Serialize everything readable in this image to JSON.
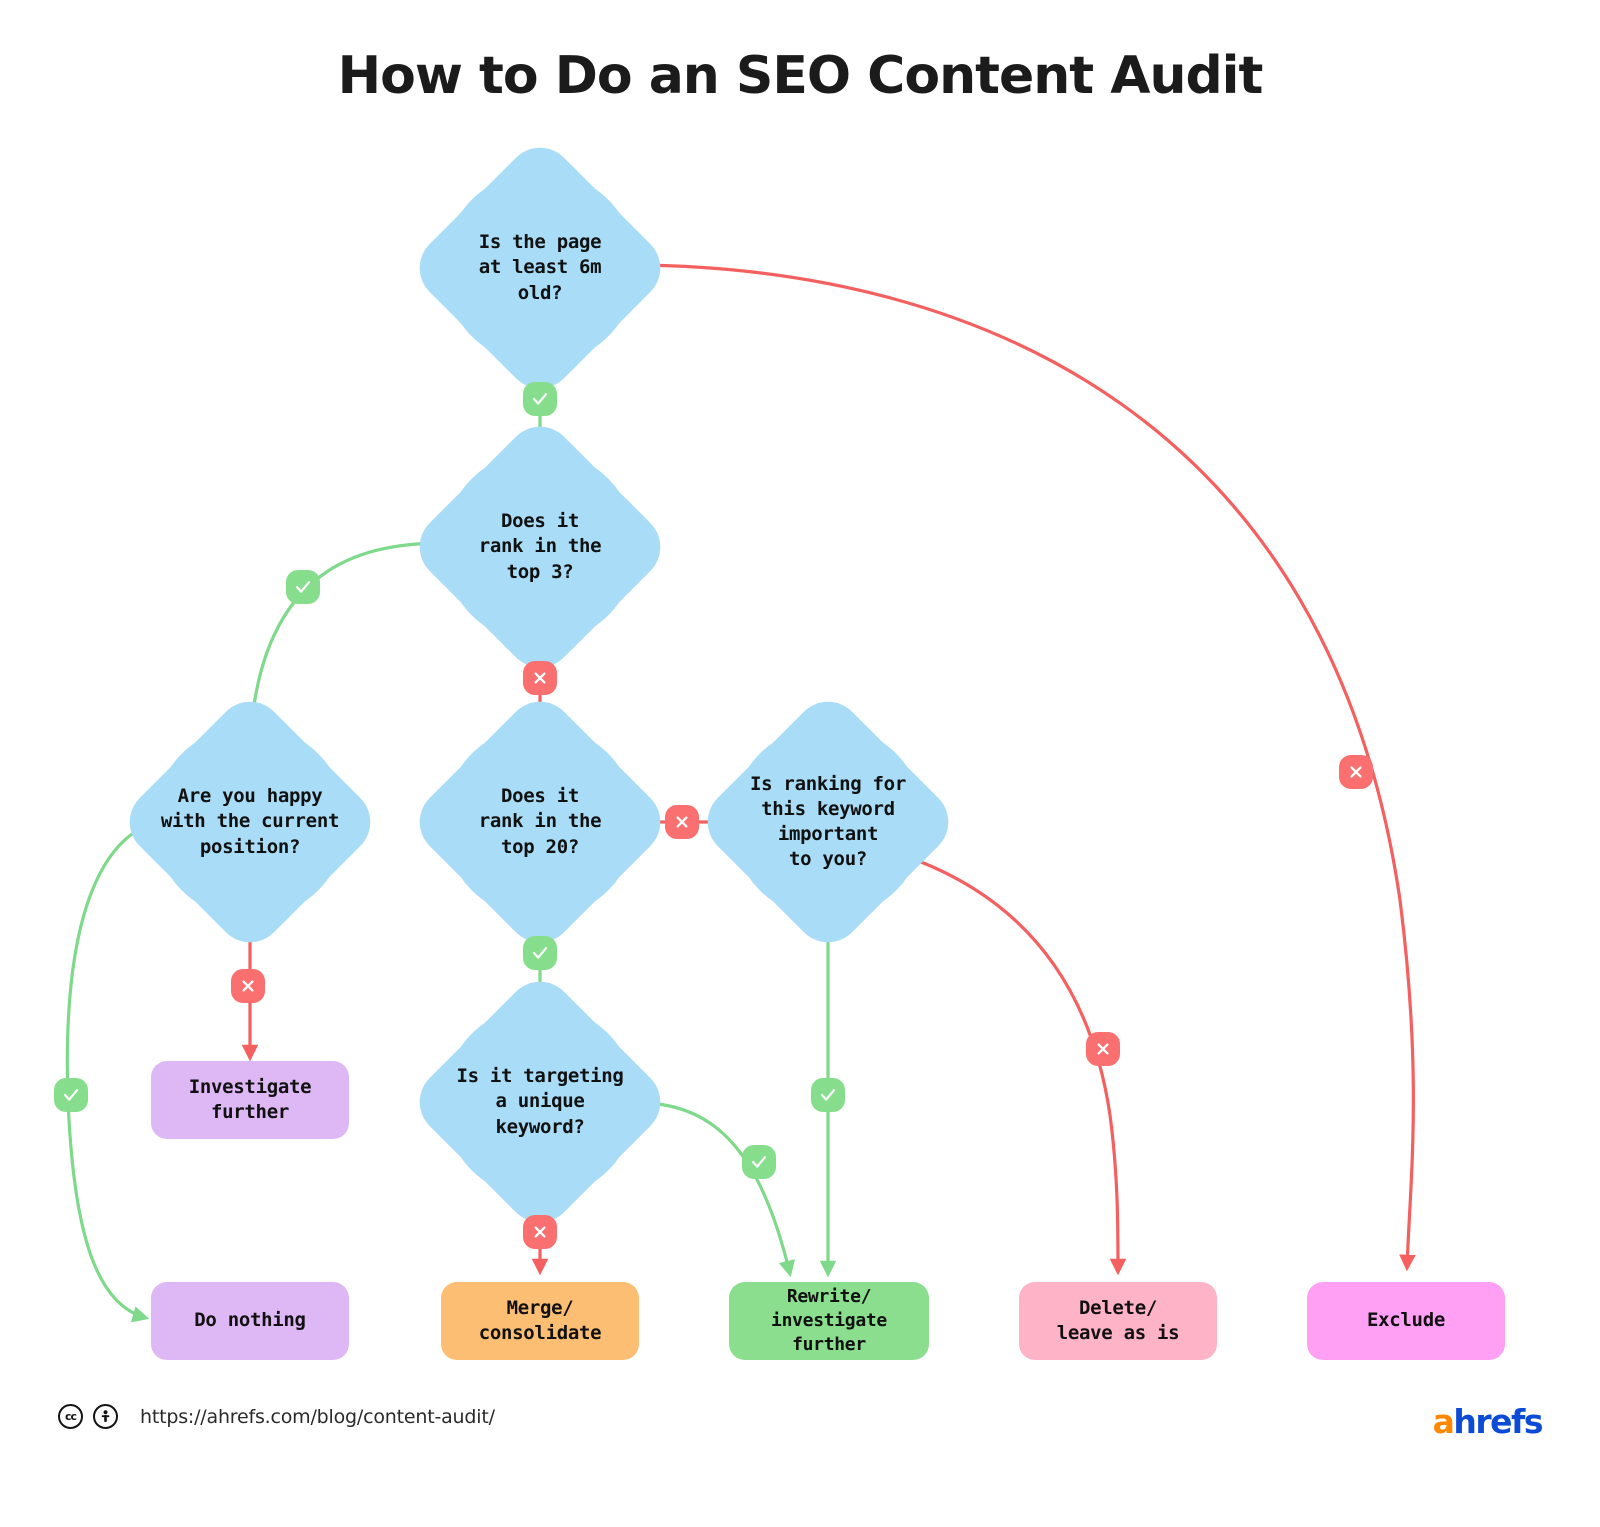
{
  "title": "How to Do an SEO Content Audit",
  "colors": {
    "decision_fill": "#a8dcf7",
    "yes_green": "#86de8d",
    "no_red": "#fa6f6f",
    "edge_green": "#7ed98a",
    "edge_red": "#f4605f",
    "purple_box": "#ddb8f5",
    "orange_box": "#fbbe72",
    "green_box": "#8ade8e",
    "pink_box": "#ffb3c7",
    "magenta_box": "#ffa0f5",
    "title_color": "#1b1b1b",
    "brand_orange": "#ff8800",
    "brand_blue": "#0b4bd6"
  },
  "nodes": {
    "q_age": "Is the page\nat least 6m\nold?",
    "q_top3": "Does it\nrank in the\ntop 3?",
    "q_happy": "Are you happy\nwith the current\nposition?",
    "q_top20": "Does it\nrank in the\ntop 20?",
    "q_important": "Is ranking for\nthis keyword\nimportant\nto you?",
    "q_unique": "Is it targeting\na unique\nkeyword?",
    "t_investigate": "Investigate\nfurther",
    "t_do_nothing": "Do nothing",
    "t_merge": "Merge/\nconsolidate",
    "t_rewrite": "Rewrite/\ninvestigate further",
    "t_delete": "Delete/\nleave as is",
    "t_exclude": "Exclude"
  },
  "edges": [
    {
      "id": "age-yes-top3",
      "from": "q_age",
      "to": "q_top3",
      "answer": "yes"
    },
    {
      "id": "age-no-exclude",
      "from": "q_age",
      "to": "t_exclude",
      "answer": "no"
    },
    {
      "id": "top3-yes-happy",
      "from": "q_top3",
      "to": "q_happy",
      "answer": "yes"
    },
    {
      "id": "top3-no-top20",
      "from": "q_top3",
      "to": "q_top20",
      "answer": "no"
    },
    {
      "id": "happy-yes-donothing",
      "from": "q_happy",
      "to": "t_do_nothing",
      "answer": "yes"
    },
    {
      "id": "happy-no-investigate",
      "from": "q_happy",
      "to": "t_investigate",
      "answer": "no"
    },
    {
      "id": "top20-yes-unique",
      "from": "q_top20",
      "to": "q_unique",
      "answer": "yes"
    },
    {
      "id": "top20-no-important",
      "from": "q_top20",
      "to": "q_important",
      "answer": "no"
    },
    {
      "id": "unique-no-merge",
      "from": "q_unique",
      "to": "t_merge",
      "answer": "no"
    },
    {
      "id": "unique-yes-rewrite",
      "from": "q_unique",
      "to": "t_rewrite",
      "answer": "yes"
    },
    {
      "id": "important-yes-rewrite",
      "from": "q_important",
      "to": "t_rewrite",
      "answer": "yes"
    },
    {
      "id": "important-no-delete",
      "from": "q_important",
      "to": "t_delete",
      "answer": "no"
    }
  ],
  "badges": {
    "yes_symbol": "check-icon",
    "no_symbol": "cross-icon"
  },
  "footer": {
    "cc_label": "cc",
    "by_label": "by-icon",
    "url": "https://ahrefs.com/blog/content-audit/",
    "brand_first": "a",
    "brand_rest": "hrefs"
  }
}
